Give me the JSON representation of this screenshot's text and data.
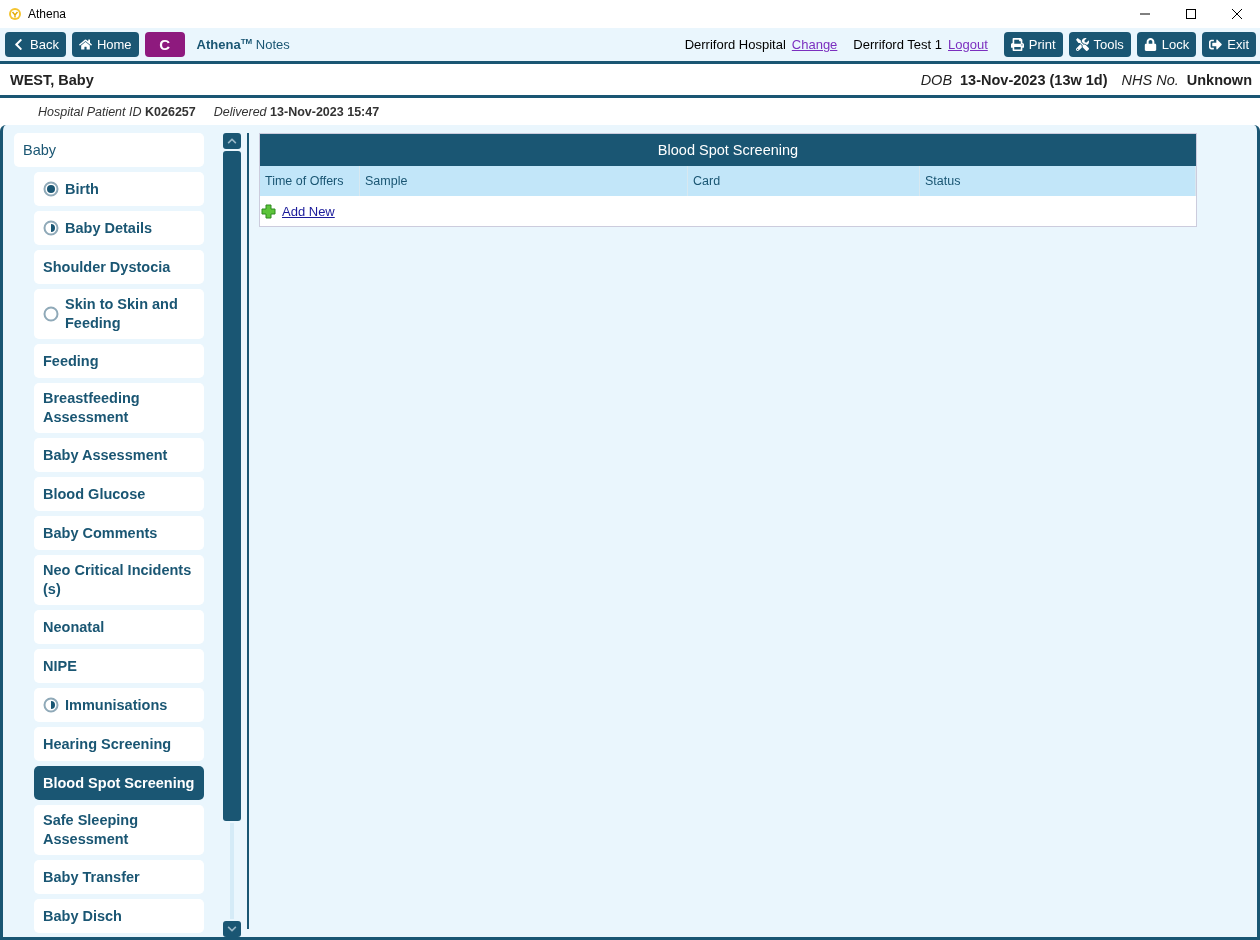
{
  "window": {
    "title": "Athena"
  },
  "toolbar": {
    "buttons": [
      {
        "kind": "back",
        "label": "Back"
      },
      {
        "kind": "home",
        "label": "Home"
      },
      {
        "kind": "badge",
        "label": "C"
      }
    ],
    "app_name": "Athena",
    "app_mark": "TM",
    "app_suffix": "Notes",
    "hospital": "Derriford Hospital",
    "change_link": "Change",
    "user": "Derriford Test 1",
    "logout_link": "Logout",
    "actions": [
      {
        "kind": "print",
        "label": "Print"
      },
      {
        "kind": "tools",
        "label": "Tools"
      },
      {
        "kind": "lock",
        "label": "Lock"
      },
      {
        "kind": "exit",
        "label": "Exit"
      }
    ]
  },
  "patient": {
    "name": "WEST, Baby",
    "dob_label": "DOB",
    "dob": "13-Nov-2023 (13w 1d)",
    "nhs_label": "NHS No.",
    "nhs": "Unknown",
    "id_label": "Hospital Patient ID",
    "id": "K026257",
    "delivered_label": "Delivered",
    "delivered": "13-Nov-2023 15:47"
  },
  "sidebar": {
    "items": [
      {
        "label": "Baby",
        "selected": false,
        "children": [
          {
            "label": "Birth",
            "kind": "full",
            "selected": false
          },
          {
            "label": "Baby Details",
            "kind": "half",
            "selected": false
          },
          {
            "label": "Shoulder Dystocia",
            "kind": "plain",
            "selected": false
          },
          {
            "label": "Skin to Skin and Feeding",
            "kind": "empty",
            "selected": false
          },
          {
            "label": "Feeding",
            "kind": "plain",
            "selected": false
          },
          {
            "label": "Breastfeeding Assessment",
            "kind": "plain",
            "selected": false
          },
          {
            "label": "Baby Assessment",
            "kind": "plain",
            "selected": false
          },
          {
            "label": "Blood Glucose",
            "kind": "plain",
            "selected": false
          },
          {
            "label": "Baby Comments",
            "kind": "plain",
            "selected": false
          },
          {
            "label": "Neo Critical Incidents (s)",
            "kind": "plain",
            "selected": false
          },
          {
            "label": "Neonatal",
            "kind": "plain",
            "selected": false
          },
          {
            "label": "NIPE",
            "kind": "plain",
            "selected": false
          },
          {
            "label": "Immunisations",
            "kind": "half",
            "selected": false
          },
          {
            "label": "Hearing Screening",
            "kind": "plain",
            "selected": false
          },
          {
            "label": "Blood Spot Screening",
            "kind": "plain",
            "selected": true
          },
          {
            "label": "Safe Sleeping Assessment",
            "kind": "plain",
            "selected": false
          },
          {
            "label": "Baby Transfer",
            "kind": "plain",
            "selected": false
          },
          {
            "label": "Baby Disch",
            "kind": "plain",
            "selected": false
          }
        ]
      }
    ]
  },
  "table": {
    "title": "Blood Spot Screening",
    "columns": [
      "Time of Offers",
      "Sample",
      "Card",
      "Status"
    ],
    "add_link": "Add New"
  }
}
